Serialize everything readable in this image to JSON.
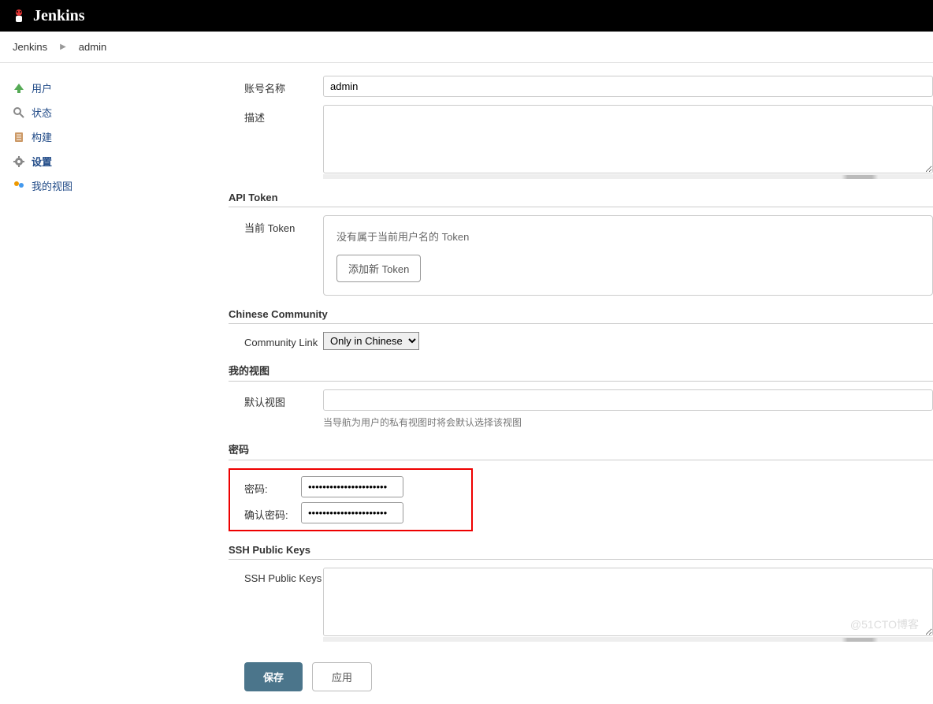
{
  "header": {
    "title": "Jenkins"
  },
  "breadcrumb": {
    "items": [
      "Jenkins",
      "admin"
    ]
  },
  "sidebar": {
    "items": [
      {
        "label": "用户",
        "icon": "user"
      },
      {
        "label": "状态",
        "icon": "status"
      },
      {
        "label": "构建",
        "icon": "build"
      },
      {
        "label": "设置",
        "icon": "settings",
        "active": true
      },
      {
        "label": "我的视图",
        "icon": "views"
      }
    ]
  },
  "form": {
    "account_label": "账号名称",
    "account_value": "admin",
    "desc_label": "描述",
    "desc_value": "",
    "api_token_title": "API Token",
    "current_token_label": "当前 Token",
    "token_msg": "没有属于当前用户名的 Token",
    "add_token_btn": "添加新 Token",
    "community_title": "Chinese Community",
    "community_link_label": "Community Link",
    "community_link_value": "Only in Chinese",
    "myviews_title": "我的视图",
    "default_view_label": "默认视图",
    "default_view_value": "",
    "default_view_help": "当导航为用户的私有视图时将会默认选择该视图",
    "password_title": "密码",
    "password_label": "密码:",
    "password_value": "••••••••••••••••••••••",
    "confirm_password_label": "确认密码:",
    "confirm_password_value": "••••••••••••••••••••••",
    "ssh_title": "SSH Public Keys",
    "ssh_label": "SSH Public Keys",
    "ssh_value": ""
  },
  "buttons": {
    "save": "保存",
    "apply": "应用"
  },
  "watermark": "@51CTO博客"
}
